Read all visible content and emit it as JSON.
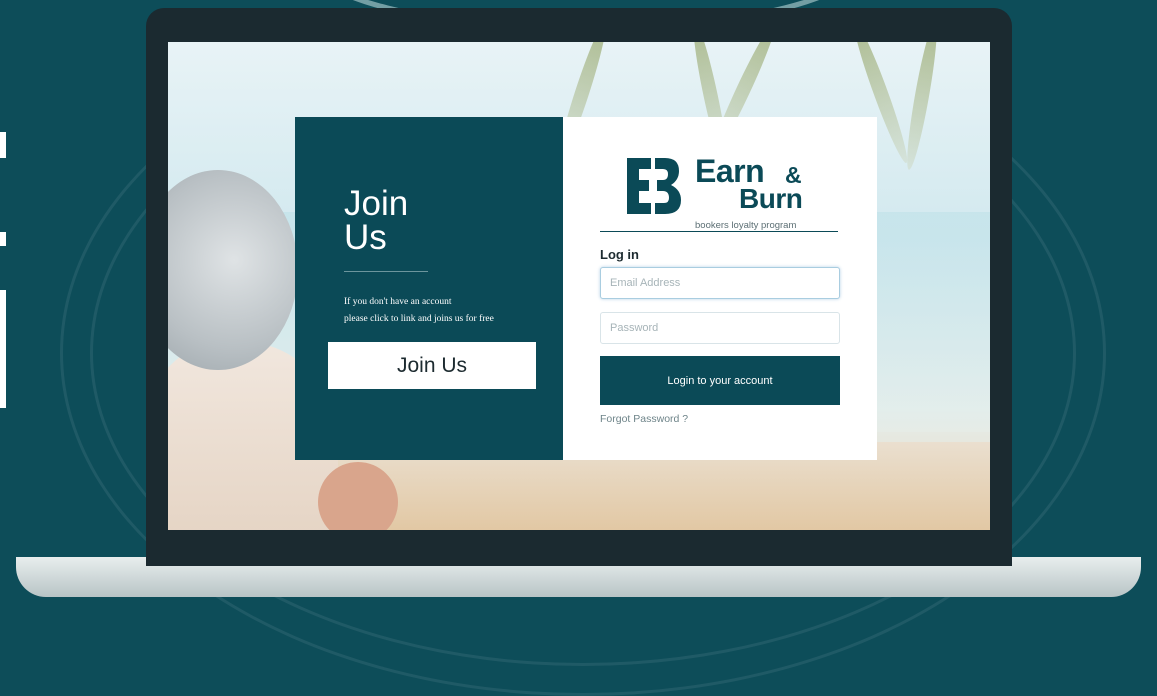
{
  "join": {
    "title_line1": "Join",
    "title_line2": "Us",
    "text_line1": "If you don't have an account",
    "text_line2": "please click to link and joins us for free",
    "button_label": "Join Us"
  },
  "brand": {
    "logo_word1": "Earn",
    "logo_amp": "&",
    "logo_word2": "Burn",
    "tagline": "bookers loyalty program",
    "logo_icon": "eb-monogram-icon",
    "accent_color": "#0b4a57"
  },
  "login": {
    "heading": "Log in",
    "email_placeholder": "Email Address",
    "password_placeholder": "Password",
    "button_label": "Login to your account",
    "forgot_label": "Forgot Password ?"
  }
}
